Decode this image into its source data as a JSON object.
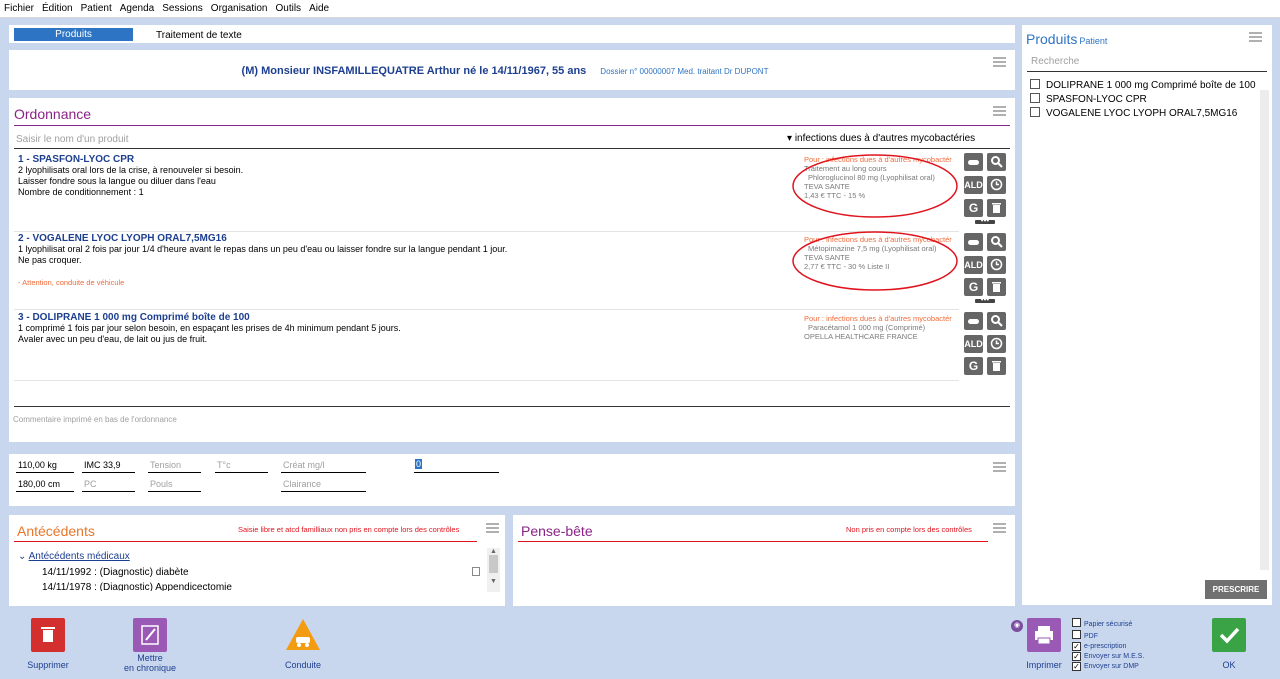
{
  "menu": [
    "Fichier",
    "Édition",
    "Patient",
    "Agenda",
    "Sessions",
    "Organisation",
    "Outils",
    "Aide"
  ],
  "tabs": {
    "active": "Produits",
    "other": "Traitement de texte"
  },
  "patient": {
    "name": "(M) Monsieur INSFAMILLEQUATRE Arthur né le 14/11/1967, 55 ans",
    "dossier": "Dossier n° 00000007 Med. traitant Dr DUPONT"
  },
  "ordonnance": {
    "title": "Ordonnance",
    "search_placeholder": "Saisir le nom d'un produit",
    "indication_label": "infections dues à d'autres mycobactéries",
    "items": [
      {
        "title": "1 - SPASFON-LYOC CPR",
        "body": "2 lyophilisats oral lors de la crise, à renouveler si besoin.\nLaisser fondre sous la langue ou diluer dans l'eau\nNombre de conditionnement : 1",
        "warning": "",
        "pour": "Pour : infections dues à d'autres mycobactér",
        "lines": [
          "Traitement au long cours",
          "Phloroglucinol 80 mg (Lyophilisat oral)",
          "TEVA SANTE",
          "1,43 € TTC - 15 %"
        ]
      },
      {
        "title": "2 - VOGALENE LYOC LYOPH ORAL7,5MG16",
        "body": "1 lyophilisat oral 2 fois par jour 1/4 d'heure avant le repas dans un peu d'eau ou laisser fondre sur la langue pendant 1 jour.\nNe pas croquer.",
        "warning": "- Attention, conduite de véhicule",
        "pour": "Pour : infections dues à d'autres mycobactér",
        "lines": [
          "Métopimazine 7,5 mg (Lyophilisat oral)",
          "TEVA SANTE",
          "2,77 € TTC - 30 % Liste II"
        ]
      },
      {
        "title": "3 - DOLIPRANE 1 000 mg Comprimé boîte de 100",
        "body": "1 comprimé 1 fois par jour selon besoin, en espaçant les prises de 4h minimum pendant 5 jours.\nAvaler avec un peu d'eau, de lait ou jus de fruit.",
        "warning": "",
        "pour": "Pour : infections dues à d'autres mycobactér",
        "lines": [
          "Paracétamol 1 000 mg (Comprimé)",
          "OPELLA HEALTHCARE FRANCE"
        ]
      }
    ],
    "btn_ald": "ALD",
    "btn_g": "G",
    "comment_placeholder": "Commentaire imprimé en bas de l'ordonnance"
  },
  "measures": {
    "poids": "110,00 kg",
    "imc": "IMC 33,9",
    "tension": "Tension",
    "temp": "T°c",
    "creat": "Créat mg/l",
    "val": "0",
    "taille": "180,00 cm",
    "pc": "PC",
    "pouls": "Pouls",
    "clairance": "Clairance"
  },
  "antecedents": {
    "title": "Antécédents",
    "note": "Saisie libre et atcd familliaux non pris en compte lors des contrôles",
    "group": "Antécédents médicaux",
    "rows": [
      "14/11/1992 : (Diagnostic) diabète",
      "14/11/1978 : (Diagnostic) Appendicectomie"
    ]
  },
  "pense_bete": {
    "title": "Pense-bête",
    "note": "Non pris en compte lors des contrôles"
  },
  "produits": {
    "title": "Produits",
    "subtitle": "Patient",
    "search_placeholder": "Recherche",
    "items": [
      "DOLIPRANE 1 000 mg Comprimé boîte de 100",
      "SPASFON-LYOC CPR",
      "VOGALENE LYOC LYOPH ORAL7,5MG16"
    ],
    "prescrire": "PRESCRIRE"
  },
  "bottom": {
    "supprimer": "Supprimer",
    "chronique": "Mettre\nen chronique",
    "conduite": "Conduite",
    "imprimer": "Imprimer",
    "ok": "OK",
    "checks": [
      {
        "label": "Papier sécurisé",
        "checked": false
      },
      {
        "label": "PDF",
        "checked": false
      },
      {
        "label": "e-prescription",
        "checked": true
      },
      {
        "label": "Envoyer sur M.E.S.",
        "checked": true
      },
      {
        "label": "Envoyer sur DMP",
        "checked": true
      }
    ]
  },
  "colors": {
    "accent": "#2e74c4",
    "ordonnance_title": "#8a2387",
    "antecedents_title": "#e8762b",
    "supprimer": "#d42f2f",
    "chronique": "#9b59b6",
    "conduite": "#f39c12",
    "ok": "#3aa346",
    "imprimer": "#9b59b6",
    "annotation": "#e0141e"
  }
}
